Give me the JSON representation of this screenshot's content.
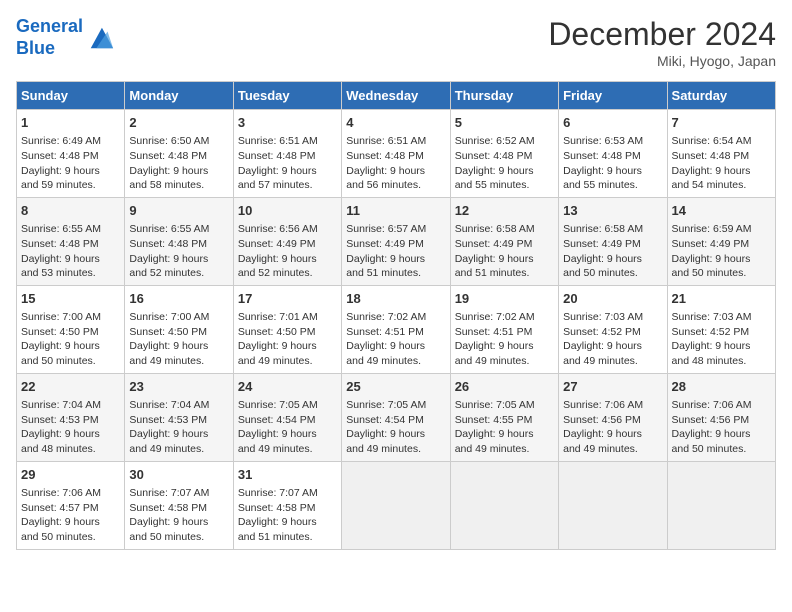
{
  "header": {
    "logo_line1": "General",
    "logo_line2": "Blue",
    "month": "December 2024",
    "location": "Miki, Hyogo, Japan"
  },
  "days_of_week": [
    "Sunday",
    "Monday",
    "Tuesday",
    "Wednesday",
    "Thursday",
    "Friday",
    "Saturday"
  ],
  "weeks": [
    [
      {
        "day": 1,
        "lines": [
          "Sunrise: 6:49 AM",
          "Sunset: 4:48 PM",
          "Daylight: 9 hours",
          "and 59 minutes."
        ]
      },
      {
        "day": 2,
        "lines": [
          "Sunrise: 6:50 AM",
          "Sunset: 4:48 PM",
          "Daylight: 9 hours",
          "and 58 minutes."
        ]
      },
      {
        "day": 3,
        "lines": [
          "Sunrise: 6:51 AM",
          "Sunset: 4:48 PM",
          "Daylight: 9 hours",
          "and 57 minutes."
        ]
      },
      {
        "day": 4,
        "lines": [
          "Sunrise: 6:51 AM",
          "Sunset: 4:48 PM",
          "Daylight: 9 hours",
          "and 56 minutes."
        ]
      },
      {
        "day": 5,
        "lines": [
          "Sunrise: 6:52 AM",
          "Sunset: 4:48 PM",
          "Daylight: 9 hours",
          "and 55 minutes."
        ]
      },
      {
        "day": 6,
        "lines": [
          "Sunrise: 6:53 AM",
          "Sunset: 4:48 PM",
          "Daylight: 9 hours",
          "and 55 minutes."
        ]
      },
      {
        "day": 7,
        "lines": [
          "Sunrise: 6:54 AM",
          "Sunset: 4:48 PM",
          "Daylight: 9 hours",
          "and 54 minutes."
        ]
      }
    ],
    [
      {
        "day": 8,
        "lines": [
          "Sunrise: 6:55 AM",
          "Sunset: 4:48 PM",
          "Daylight: 9 hours",
          "and 53 minutes."
        ]
      },
      {
        "day": 9,
        "lines": [
          "Sunrise: 6:55 AM",
          "Sunset: 4:48 PM",
          "Daylight: 9 hours",
          "and 52 minutes."
        ]
      },
      {
        "day": 10,
        "lines": [
          "Sunrise: 6:56 AM",
          "Sunset: 4:49 PM",
          "Daylight: 9 hours",
          "and 52 minutes."
        ]
      },
      {
        "day": 11,
        "lines": [
          "Sunrise: 6:57 AM",
          "Sunset: 4:49 PM",
          "Daylight: 9 hours",
          "and 51 minutes."
        ]
      },
      {
        "day": 12,
        "lines": [
          "Sunrise: 6:58 AM",
          "Sunset: 4:49 PM",
          "Daylight: 9 hours",
          "and 51 minutes."
        ]
      },
      {
        "day": 13,
        "lines": [
          "Sunrise: 6:58 AM",
          "Sunset: 4:49 PM",
          "Daylight: 9 hours",
          "and 50 minutes."
        ]
      },
      {
        "day": 14,
        "lines": [
          "Sunrise: 6:59 AM",
          "Sunset: 4:49 PM",
          "Daylight: 9 hours",
          "and 50 minutes."
        ]
      }
    ],
    [
      {
        "day": 15,
        "lines": [
          "Sunrise: 7:00 AM",
          "Sunset: 4:50 PM",
          "Daylight: 9 hours",
          "and 50 minutes."
        ]
      },
      {
        "day": 16,
        "lines": [
          "Sunrise: 7:00 AM",
          "Sunset: 4:50 PM",
          "Daylight: 9 hours",
          "and 49 minutes."
        ]
      },
      {
        "day": 17,
        "lines": [
          "Sunrise: 7:01 AM",
          "Sunset: 4:50 PM",
          "Daylight: 9 hours",
          "and 49 minutes."
        ]
      },
      {
        "day": 18,
        "lines": [
          "Sunrise: 7:02 AM",
          "Sunset: 4:51 PM",
          "Daylight: 9 hours",
          "and 49 minutes."
        ]
      },
      {
        "day": 19,
        "lines": [
          "Sunrise: 7:02 AM",
          "Sunset: 4:51 PM",
          "Daylight: 9 hours",
          "and 49 minutes."
        ]
      },
      {
        "day": 20,
        "lines": [
          "Sunrise: 7:03 AM",
          "Sunset: 4:52 PM",
          "Daylight: 9 hours",
          "and 49 minutes."
        ]
      },
      {
        "day": 21,
        "lines": [
          "Sunrise: 7:03 AM",
          "Sunset: 4:52 PM",
          "Daylight: 9 hours",
          "and 48 minutes."
        ]
      }
    ],
    [
      {
        "day": 22,
        "lines": [
          "Sunrise: 7:04 AM",
          "Sunset: 4:53 PM",
          "Daylight: 9 hours",
          "and 48 minutes."
        ]
      },
      {
        "day": 23,
        "lines": [
          "Sunrise: 7:04 AM",
          "Sunset: 4:53 PM",
          "Daylight: 9 hours",
          "and 49 minutes."
        ]
      },
      {
        "day": 24,
        "lines": [
          "Sunrise: 7:05 AM",
          "Sunset: 4:54 PM",
          "Daylight: 9 hours",
          "and 49 minutes."
        ]
      },
      {
        "day": 25,
        "lines": [
          "Sunrise: 7:05 AM",
          "Sunset: 4:54 PM",
          "Daylight: 9 hours",
          "and 49 minutes."
        ]
      },
      {
        "day": 26,
        "lines": [
          "Sunrise: 7:05 AM",
          "Sunset: 4:55 PM",
          "Daylight: 9 hours",
          "and 49 minutes."
        ]
      },
      {
        "day": 27,
        "lines": [
          "Sunrise: 7:06 AM",
          "Sunset: 4:56 PM",
          "Daylight: 9 hours",
          "and 49 minutes."
        ]
      },
      {
        "day": 28,
        "lines": [
          "Sunrise: 7:06 AM",
          "Sunset: 4:56 PM",
          "Daylight: 9 hours",
          "and 50 minutes."
        ]
      }
    ],
    [
      {
        "day": 29,
        "lines": [
          "Sunrise: 7:06 AM",
          "Sunset: 4:57 PM",
          "Daylight: 9 hours",
          "and 50 minutes."
        ]
      },
      {
        "day": 30,
        "lines": [
          "Sunrise: 7:07 AM",
          "Sunset: 4:58 PM",
          "Daylight: 9 hours",
          "and 50 minutes."
        ]
      },
      {
        "day": 31,
        "lines": [
          "Sunrise: 7:07 AM",
          "Sunset: 4:58 PM",
          "Daylight: 9 hours",
          "and 51 minutes."
        ]
      },
      null,
      null,
      null,
      null
    ]
  ]
}
